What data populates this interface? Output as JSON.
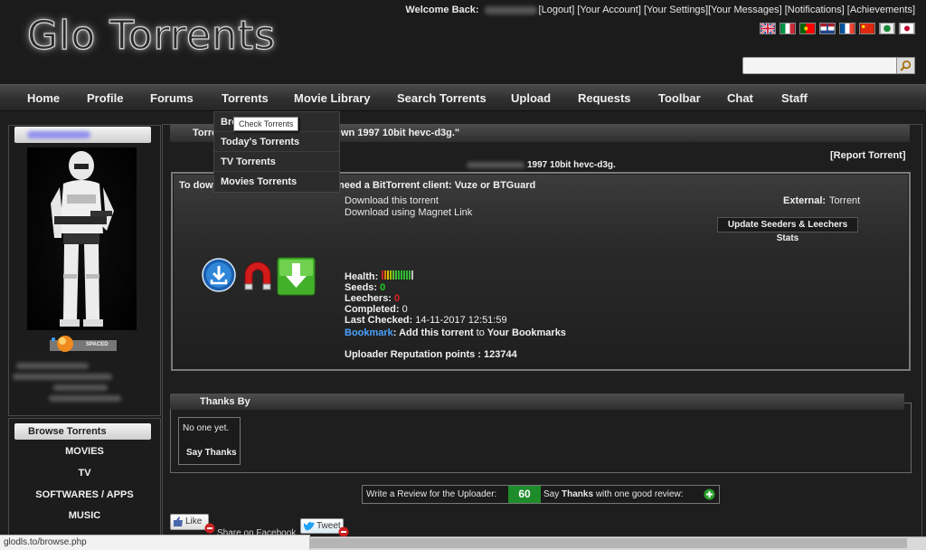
{
  "header": {
    "logo_text": "Glo Torrents",
    "welcome_label": "Welcome Back:",
    "links": [
      "[Logout]",
      "[Your Account]",
      "[Your Settings]",
      "[Your Messages]",
      "[Notifications]",
      "[Achievements]"
    ],
    "flags": [
      "uk-flag",
      "italy-flag",
      "portugal-flag",
      "netherlands-flag",
      "france-flag",
      "china-flag",
      "saudi-flag",
      "japan-flag"
    ],
    "search": {
      "value": "",
      "placeholder": ""
    }
  },
  "nav": {
    "items": [
      "Home",
      "Profile",
      "Forums",
      "Torrents",
      "Movie Library",
      "Search Torrents",
      "Upload",
      "Requests",
      "Toolbar",
      "Chat",
      "Staff"
    ]
  },
  "dropdown": {
    "items": [
      "Bro",
      "Today's Torrents",
      "TV Torrents",
      "Movies Torrents"
    ],
    "tooltip": "Check Torrents"
  },
  "sidebar": {
    "rank_label": "SPACED",
    "browse_title": "Browse Torrents",
    "browse_items": [
      "MOVIES",
      "TV",
      "SOFTWARES / APPS",
      "MUSIC"
    ]
  },
  "main": {
    "title_prefix": "Torre",
    "title_suffix": "wn 1997 10bit hevc-d3g.\"",
    "report_link": "[Report Torrent]",
    "uploader_suffix": "1997 10bit hevc-d3g.",
    "download": {
      "header_prefix": "To dow",
      "header_suffix": "need a BitTorrent client: Vuze or BTGuard",
      "download_torrent": "Download this torrent",
      "download_magnet": "Download using Magnet Link",
      "external_label": "External:",
      "external_value": "Torrent",
      "update_button": "Update Seeders & Leechers Stats",
      "health_label": "Health:",
      "seeds_label": "Seeds:",
      "seeds_value": "0",
      "leechers_label": "Leechers:",
      "leechers_value": "0",
      "completed_label": "Completed:",
      "completed_value": "0",
      "last_checked_label": "Last Checked:",
      "last_checked_value": "14-11-2017 12:51:59",
      "bookmark_link": "Bookmark",
      "bookmark_text": ": Add this torrent",
      "bookmark_to": "to",
      "bookmark_target": "Your Bookmarks",
      "reputation_label": "Uploader Reputation points : 123744"
    },
    "thanks": {
      "title": "Thanks By",
      "none_text": "No one yet.",
      "say_thanks": "Say Thanks"
    },
    "review": {
      "label": "Write a Review for the Uploader:",
      "score": "60",
      "text_prefix": "Say",
      "text_bold": "Thanks",
      "text_suffix": "with one good review:"
    },
    "social": {
      "like": "Like",
      "share": "Share on Facebook",
      "tweet": "Tweet"
    }
  },
  "status_bar": {
    "url": "glodls.to/browse.php"
  }
}
